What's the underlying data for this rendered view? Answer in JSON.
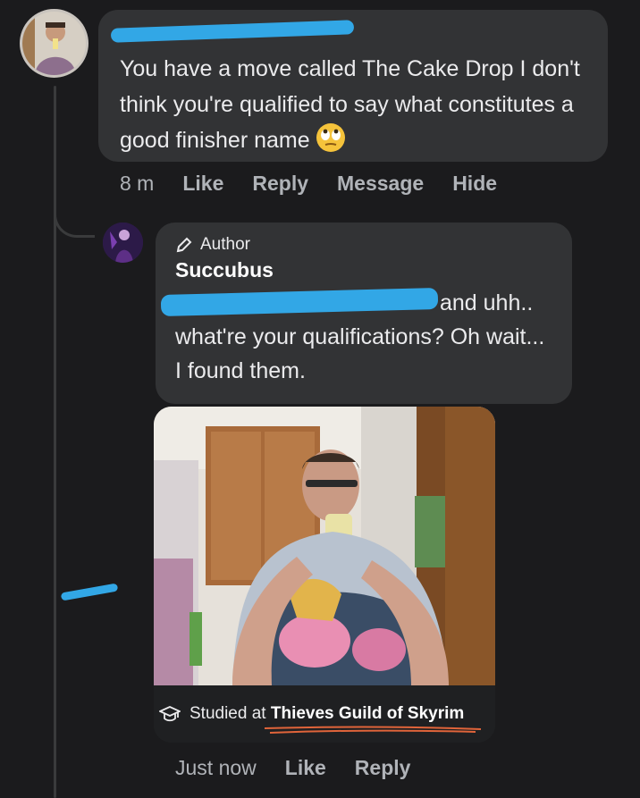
{
  "comment1": {
    "text": "You have a move called The Cake Drop I don't think you're qualified to say what constitutes a good finisher name",
    "emoji": "rolling-eyes-emoji",
    "timestamp": "8 m",
    "like_label": "Like",
    "reply_label": "Reply",
    "message_label": "Message",
    "hide_label": "Hide"
  },
  "comment2": {
    "badge_label": "Author",
    "author_name": "Succubus",
    "text_line1": "and uhh..",
    "text_rest": "what're your qualifications? Oh wait... I found them.",
    "attachment_caption_prefix": "Studied at",
    "attachment_caption_place": "Thieves Guild of Skyrim",
    "attachment_icon": "graduation-cap-icon",
    "timestamp": "Just now",
    "like_label": "Like",
    "reply_label": "Reply"
  },
  "colors": {
    "background": "#1b1b1d",
    "bubble": "#323335",
    "redaction": "#32a7e6",
    "underline": "#e0643a"
  }
}
